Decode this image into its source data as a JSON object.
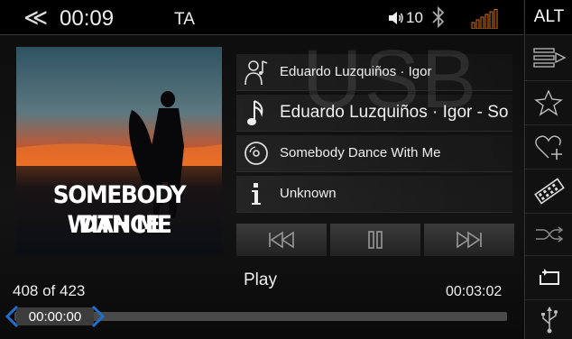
{
  "status": {
    "clock": "00:09",
    "ta": "TA",
    "volume": "10",
    "icons": [
      "back-icon",
      "volume-icon",
      "bluetooth-icon",
      "signal-icon"
    ]
  },
  "rail": {
    "alt_label": "ALT",
    "icons": [
      "playlist-icon",
      "favorite-star-icon",
      "add-favorite-icon",
      "media-browse-icon",
      "shuffle-icon",
      "repeat-icon",
      "usb-icon"
    ]
  },
  "source_watermark": "USB",
  "album_art": {
    "title_line1": "SOMEBODY DANCE",
    "title_line2": "WITH ME"
  },
  "info": {
    "artist": "Eduardo Luzquiños · Igor",
    "track": "Eduardo Luzquiños · Igor - Sor",
    "album": "Somebody Dance With Me",
    "genre": "Unknown"
  },
  "player": {
    "state_label": "Play",
    "track_count": "408 of 423",
    "duration": "00:03:02",
    "elapsed": "00:00:00",
    "progress": 0.0
  },
  "colors": {
    "accent": "#1e6fd0",
    "signal": "#d6701c"
  }
}
